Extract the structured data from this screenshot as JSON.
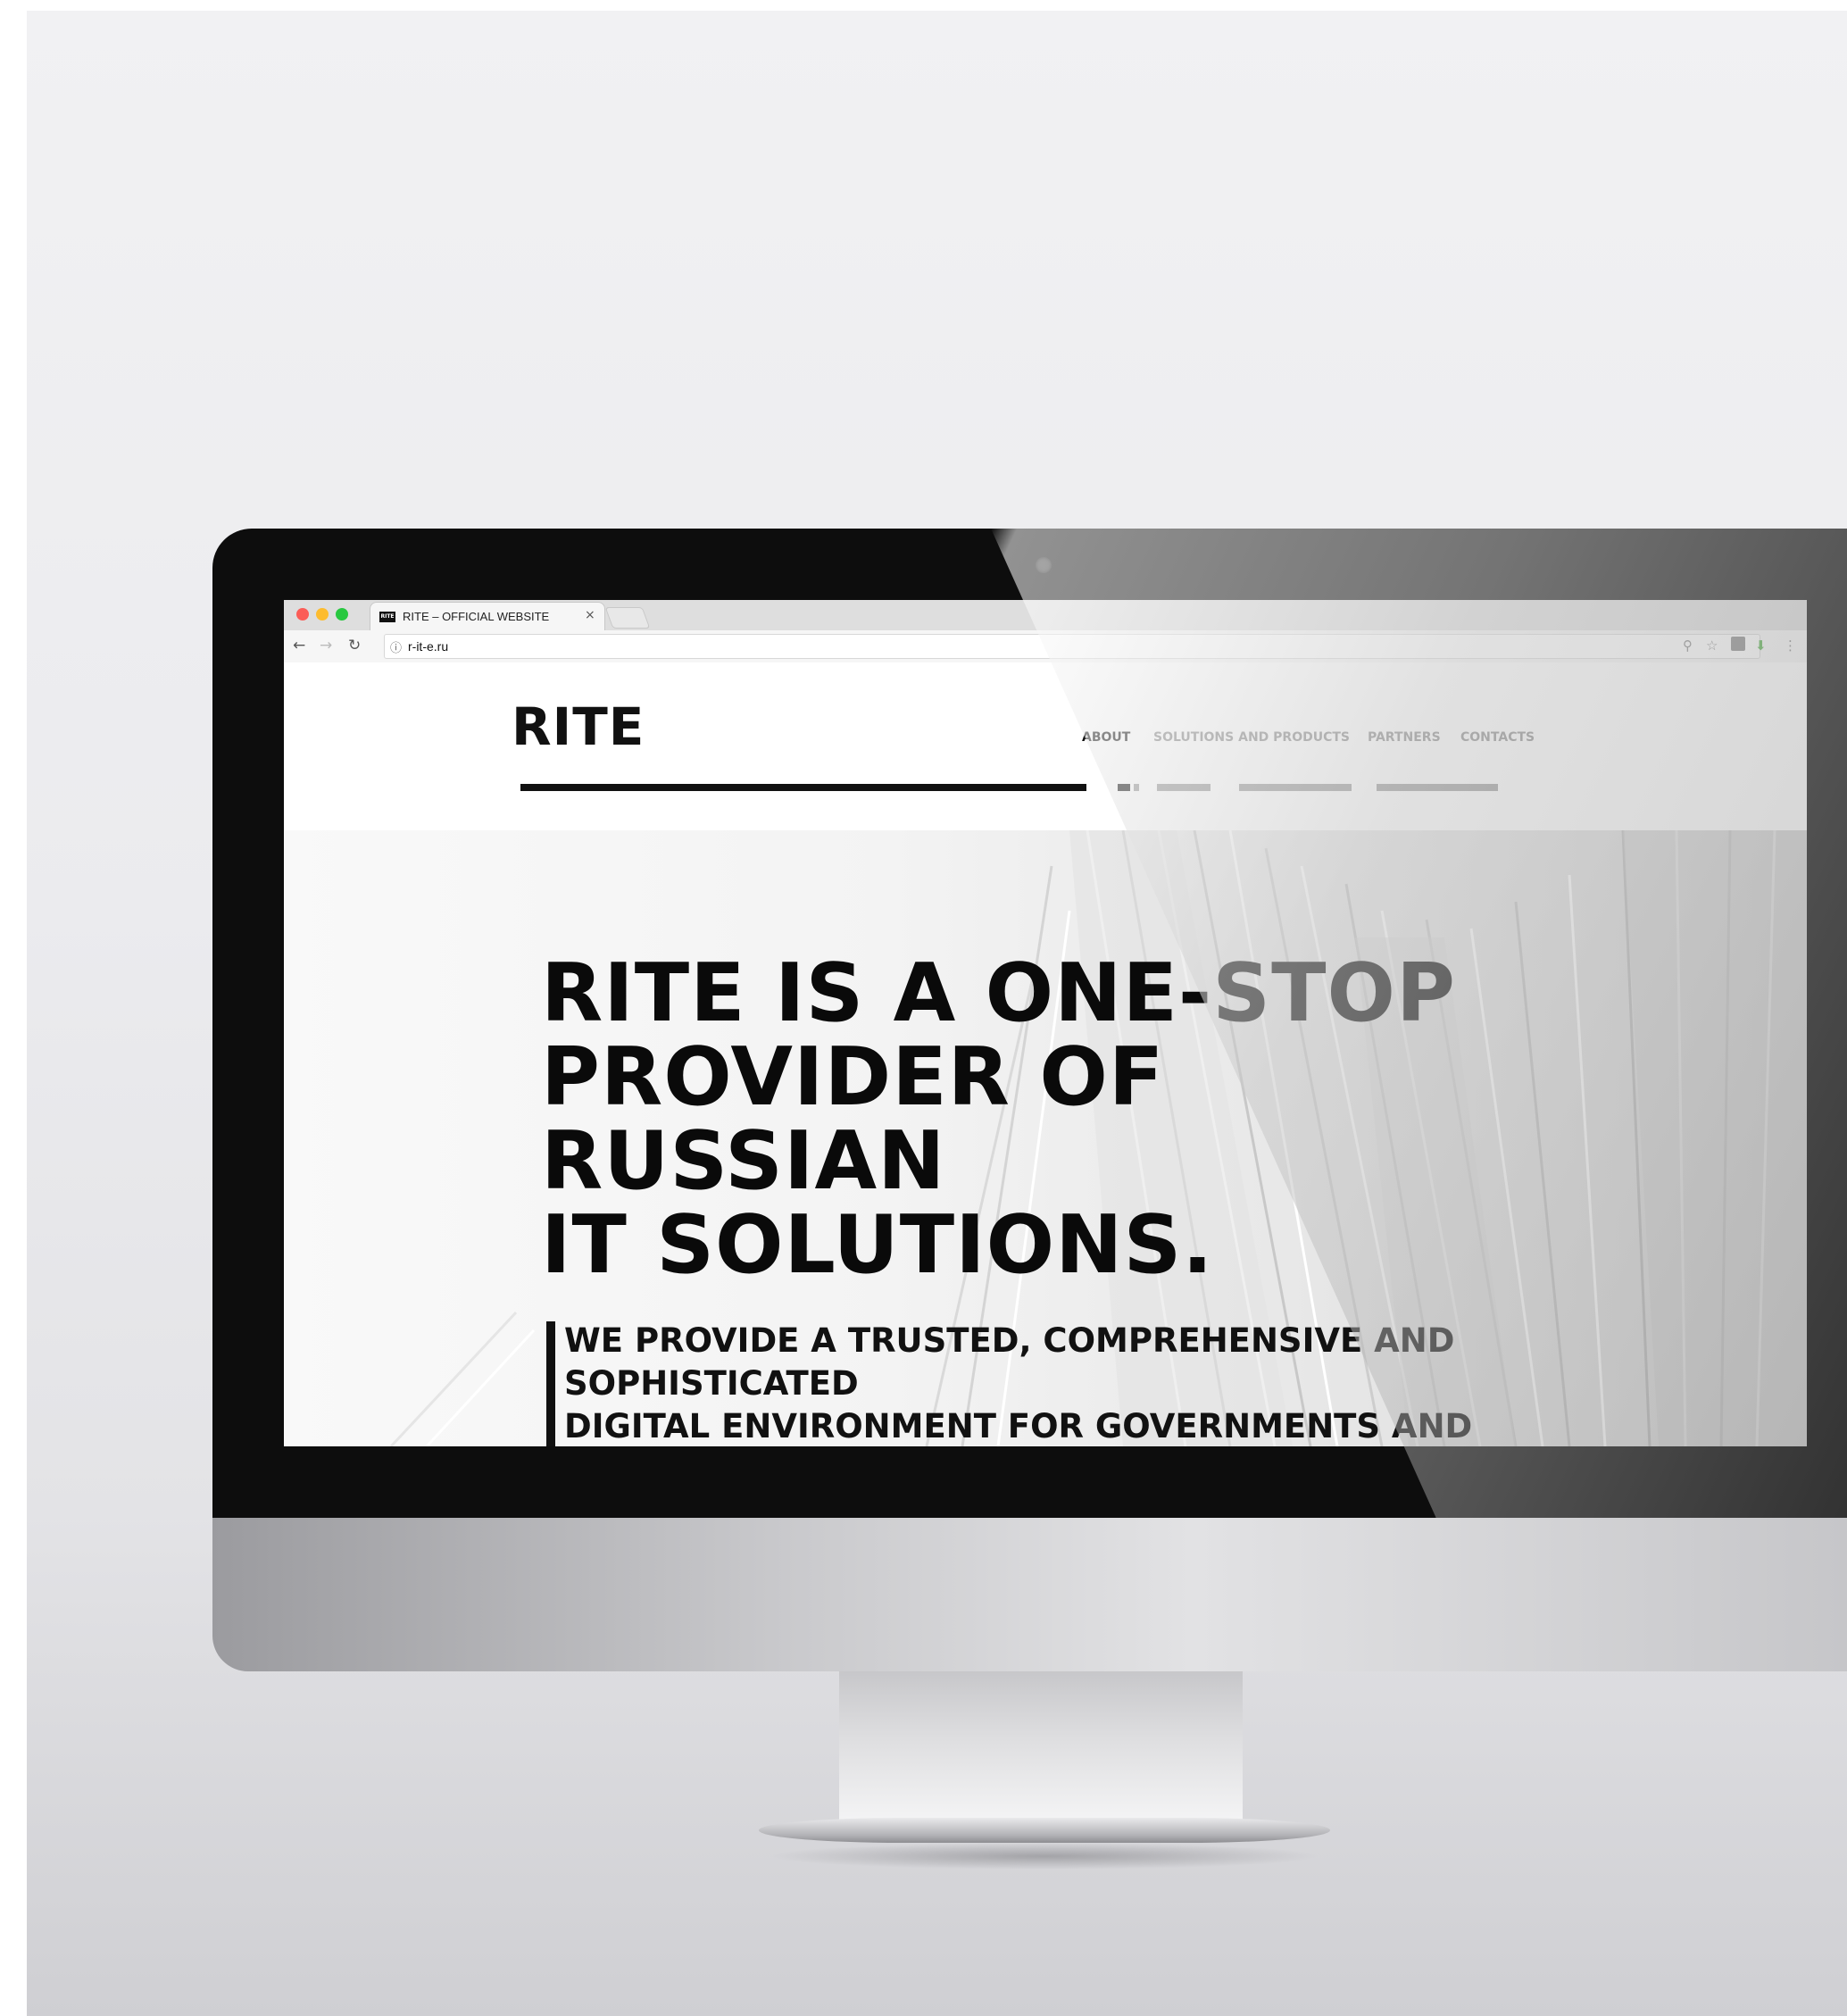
{
  "browser": {
    "tab_title": "RITE – OFFICIAL WEBSITE",
    "tab_favicon": "RITE",
    "url": "r-it-e.ru"
  },
  "site": {
    "logo": "RITE",
    "nav": [
      "ABOUT",
      "SOLUTIONS AND PRODUCTS",
      "PARTNERS",
      "CONTACTS"
    ]
  },
  "hero": {
    "title_lines": [
      "RITE IS A ONE-STOP",
      "PROVIDER OF",
      "RUSSIAN",
      "IT SOLUTIONS."
    ],
    "subtitle_lines": [
      "WE PROVIDE A TRUSTED, COMPREHENSIVE AND",
      "SOPHISTICATED",
      "DIGITAL ENVIRONMENT FOR GOVERNMENTS AND"
    ]
  },
  "icons": {
    "window_controls": [
      "close-dot-icon",
      "minimize-dot-icon",
      "zoom-dot-icon"
    ],
    "navigation": [
      "back-icon",
      "forward-icon",
      "reload-icon",
      "info-icon"
    ],
    "toolbar": [
      "search-icon",
      "bookmark-star-icon",
      "extension-icon",
      "download-arrow-icon",
      "menu-kebab-icon"
    ]
  },
  "colors": {
    "window_close": "#fb5d57",
    "window_minimize": "#fdbc2f",
    "window_zoom": "#28c840",
    "brand_text": "#111111",
    "nav_muted": "#8a8a8a",
    "download_arrow": "#55b04a"
  }
}
